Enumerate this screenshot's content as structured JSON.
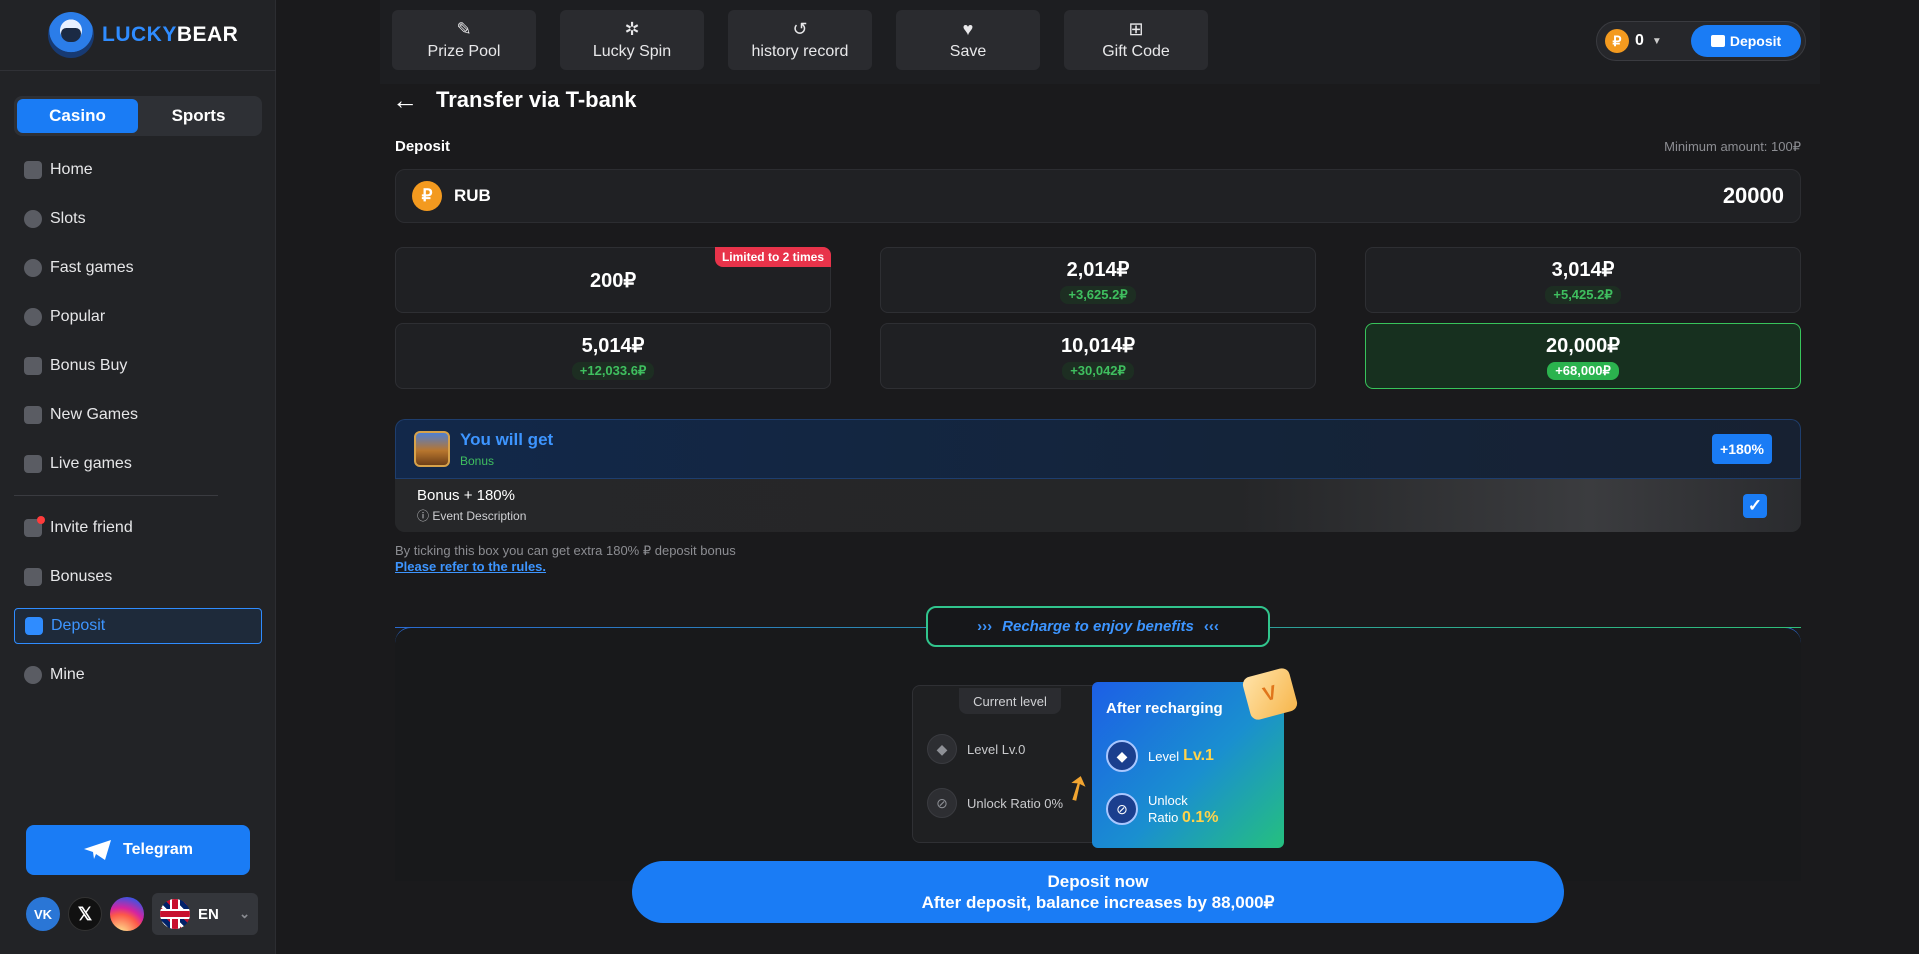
{
  "brand": {
    "part1": "LUCKY",
    "part2": "BEAR"
  },
  "mode_switch": {
    "casino": "Casino",
    "sports": "Sports"
  },
  "nav": {
    "home": "Home",
    "slots": "Slots",
    "fast_games": "Fast games",
    "popular": "Popular",
    "bonus_buy": "Bonus Buy",
    "new_games": "New Games",
    "live_games": "Live games",
    "invite_friend": "Invite friend",
    "bonuses": "Bonuses",
    "deposit": "Deposit",
    "mine": "Mine"
  },
  "telegram": "Telegram",
  "social": {
    "vk": "VK",
    "x": "𝕏"
  },
  "language": "EN",
  "topbar": {
    "tabs": [
      "Prize Pool",
      "Lucky Spin",
      "history record",
      "Save",
      "Gift Code"
    ],
    "wallet_balance": "0",
    "wallet_deposit": "Deposit"
  },
  "page": {
    "title": "Transfer via T-bank",
    "deposit_label": "Deposit",
    "minimum": "Minimum amount: 100₽",
    "currency": "RUB",
    "currency_symbol": "₽",
    "amount": "20000"
  },
  "options": [
    {
      "value": "200₽",
      "bonus": "",
      "tag": "Limited to 2 times"
    },
    {
      "value": "2,014₽",
      "bonus": "+3,625.2₽"
    },
    {
      "value": "3,014₽",
      "bonus": "+5,425.2₽"
    },
    {
      "value": "5,014₽",
      "bonus": "+12,033.6₽"
    },
    {
      "value": "10,014₽",
      "bonus": "+30,042₽"
    },
    {
      "value": "20,000₽",
      "bonus": "+68,000₽",
      "selected": true
    }
  ],
  "bonus": {
    "title": "You will get",
    "subtitle": "Bonus",
    "percent": "+180%",
    "item_title": "Bonus + 180%",
    "item_desc": "ⓘ Event Description",
    "checked": true
  },
  "hint": "By ticking this box you can get extra 180% ₽ deposit bonus",
  "rules_link": "Please refer to the rules.",
  "benefits": {
    "tag": "Recharge to enjoy benefits",
    "current_header": "Current level",
    "current_level": "Level Lv.0",
    "current_unlock": "Unlock Ratio 0%",
    "after_header": "After recharging",
    "after_level_label": "Level",
    "after_level_value": "Lv.1",
    "after_unlock_label1": "Unlock",
    "after_unlock_label2": "Ratio",
    "after_unlock_value": "0.1%"
  },
  "deposit_now": {
    "line1": "Deposit now",
    "line2": "After deposit, balance increases by 88,000₽"
  }
}
